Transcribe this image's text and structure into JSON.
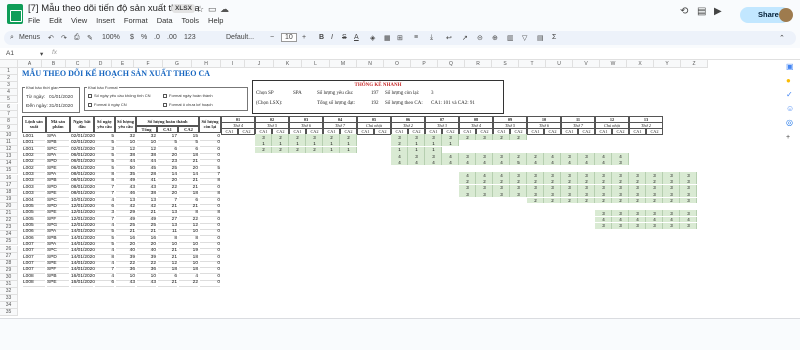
{
  "window": {
    "title": "[7] Mẫu theo dõi tiến độ sản xuất theo ca",
    "badge": "XLSX"
  },
  "menu": [
    "File",
    "Edit",
    "View",
    "Insert",
    "Format",
    "Data",
    "Tools",
    "Help"
  ],
  "share_label": "Share",
  "toolbar": {
    "menus": "Menus",
    "zoom": "100%",
    "format": "Default...",
    "font_size": "10",
    "num123": "123",
    "pct": "%"
  },
  "formula_bar": {
    "cell_ref": "A1",
    "fx": "fx"
  },
  "columns": [
    "A",
    "B",
    "C",
    "D",
    "E",
    "F",
    "G",
    "H",
    "I",
    "J",
    "K",
    "L",
    "M",
    "N",
    "O",
    "P",
    "Q",
    "R",
    "S",
    "T",
    "U",
    "V",
    "W",
    "X",
    "Y",
    "Z"
  ],
  "rows": [
    "1",
    "2",
    "3",
    "4",
    "5",
    "6",
    "7",
    "8",
    "9",
    "10",
    "11",
    "12",
    "13",
    "14",
    "15",
    "16",
    "17",
    "18",
    "19",
    "20",
    "21",
    "22",
    "23",
    "24",
    "25",
    "26",
    "27",
    "28",
    "29",
    "30",
    "31",
    "32",
    "33",
    "34",
    "35"
  ],
  "sheet": {
    "title": "MẪU THEO DÕI KẾ HOẠCH SẢN XUẤT THEO CA",
    "time_box": {
      "legend": "Khai báo thời gian",
      "from_label": "Từ ngày:",
      "from_value": "01/01/2020",
      "to_label": "Đến ngày:",
      "to_value": "31/01/2020"
    },
    "format_box": {
      "legend": "Khai báo Format",
      "opt1": "Số ngày yêu cầu không tính CN",
      "opt2": "Format ngày hoàn thành",
      "opt3": "Format ô ngày CN",
      "opt4": "Format ô chưa kế hoạch"
    },
    "stats": {
      "title": "THỐNG KÊ NHANH",
      "chon_sp": "Chọn SP",
      "sp_val": "SPA",
      "sl_yc": "Số lượng yêu cầu:",
      "sl_yc_val": "197",
      "sl_cl": "Số lượng còn lại:",
      "sl_cl_val": "3",
      "chon_lsx": "(Chọn LSX):",
      "tong": "Tổng số lượng đạt:",
      "tong_val": "192",
      "sl_ca": "Số lượng theo CA:",
      "sl_ca_val": "CA1: 101 và CA2: 91"
    },
    "headers": {
      "lenh": "Lệnh sản xuất",
      "ma": "Mã sản phẩm",
      "ngay": "Ngày bắt đầu",
      "songay": "Số ngày yêu cầu",
      "sl": "Số lượng yêu cầu",
      "slht": "Số lượng hoàn thành",
      "tong": "Tổng",
      "ca1": "CA1",
      "ca2": "CA2",
      "slcl": "Số lượng còn lại"
    },
    "dates": [
      "01",
      "02",
      "03",
      "04",
      "05",
      "06",
      "07",
      "08",
      "09",
      "10",
      "11",
      "12",
      "13"
    ],
    "days": [
      "Thứ 4",
      "Thứ 5",
      "Thứ 6",
      "Thứ 7",
      "Chủ nhật",
      "Thứ 2",
      "Thứ 3",
      "Thứ 4",
      "Thứ 5",
      "Thứ 6",
      "Thứ 7",
      "Chủ nhật",
      "Thứ 2"
    ],
    "data_rows": [
      [
        "L001",
        "SPA",
        "02/01/2020",
        "5",
        "32",
        "32",
        "17",
        "15",
        "0"
      ],
      [
        "L001",
        "SPB",
        "02/01/2020",
        "5",
        "10",
        "10",
        "5",
        "5",
        "0"
      ],
      [
        "L001",
        "SPC",
        "02/01/2020",
        "3",
        "12",
        "12",
        "6",
        "6",
        "0"
      ],
      [
        "L002",
        "SPA",
        "06/01/2020",
        "5",
        "38",
        "38",
        "20",
        "18",
        "0"
      ],
      [
        "L002",
        "SPD",
        "06/01/2020",
        "5",
        "44",
        "44",
        "23",
        "21",
        "0"
      ],
      [
        "L002",
        "SPE",
        "06/01/2020",
        "5",
        "50",
        "45",
        "25",
        "20",
        "5"
      ],
      [
        "L003",
        "SPA",
        "08/01/2020",
        "8",
        "35",
        "28",
        "14",
        "14",
        "7"
      ],
      [
        "L003",
        "SPB",
        "08/01/2020",
        "8",
        "49",
        "41",
        "20",
        "21",
        "8"
      ],
      [
        "L003",
        "SPD",
        "08/01/2020",
        "7",
        "43",
        "43",
        "22",
        "21",
        "0"
      ],
      [
        "L003",
        "SPE",
        "08/01/2020",
        "7",
        "46",
        "38",
        "20",
        "18",
        "8"
      ],
      [
        "L004",
        "SPC",
        "10/01/2020",
        "4",
        "13",
        "13",
        "7",
        "6",
        "0"
      ],
      [
        "L005",
        "SPD",
        "12/01/2020",
        "6",
        "42",
        "42",
        "21",
        "21",
        "0"
      ],
      [
        "L005",
        "SPE",
        "12/01/2020",
        "3",
        "29",
        "21",
        "13",
        "8",
        "8"
      ],
      [
        "L005",
        "SPF",
        "12/01/2020",
        "7",
        "49",
        "49",
        "27",
        "22",
        "0"
      ],
      [
        "L005",
        "SPG",
        "12/01/2020",
        "4",
        "25",
        "25",
        "13",
        "12",
        "0"
      ],
      [
        "L006",
        "SPA",
        "14/01/2020",
        "5",
        "21",
        "21",
        "11",
        "10",
        "0"
      ],
      [
        "L006",
        "SPB",
        "14/01/2020",
        "5",
        "16",
        "16",
        "8",
        "8",
        "0"
      ],
      [
        "L007",
        "SPA",
        "14/01/2020",
        "5",
        "20",
        "20",
        "10",
        "10",
        "0"
      ],
      [
        "L007",
        "SPC",
        "14/01/2020",
        "4",
        "40",
        "40",
        "21",
        "19",
        "0"
      ],
      [
        "L007",
        "SPD",
        "14/01/2020",
        "8",
        "39",
        "39",
        "21",
        "18",
        "0"
      ],
      [
        "L007",
        "SPE",
        "14/01/2020",
        "4",
        "22",
        "22",
        "12",
        "10",
        "0"
      ],
      [
        "L007",
        "SPF",
        "14/01/2020",
        "7",
        "36",
        "36",
        "18",
        "18",
        "0"
      ],
      [
        "L008",
        "SPB",
        "16/01/2020",
        "4",
        "10",
        "10",
        "6",
        "4",
        "0"
      ],
      [
        "L008",
        "SPE",
        "16/01/2020",
        "6",
        "43",
        "43",
        "21",
        "22",
        "0"
      ]
    ],
    "gantt": [
      {
        "row": 0,
        "start": 2,
        "vals": [
          "3",
          "2",
          "2",
          "3",
          "2",
          "2",
          "",
          "",
          "3",
          "3",
          "3",
          "3",
          "2",
          "3",
          "2",
          "2"
        ]
      },
      {
        "row": 1,
        "start": 2,
        "vals": [
          "1",
          "1",
          "1",
          "1",
          "1",
          "1",
          "",
          "",
          "2",
          "1",
          "1",
          "1"
        ]
      },
      {
        "row": 2,
        "start": 2,
        "vals": [
          "2",
          "2",
          "2",
          "2",
          "1",
          "1",
          "",
          "",
          "1",
          "1",
          "1"
        ]
      },
      {
        "row": 3,
        "start": 10,
        "vals": [
          "4",
          "3",
          "3",
          "4",
          "3",
          "3",
          "3",
          "2",
          "2",
          "4",
          "3",
          "3",
          "4",
          "4"
        ]
      },
      {
        "row": 4,
        "start": 10,
        "vals": [
          "4",
          "4",
          "4",
          "4",
          "4",
          "4",
          "4",
          "5",
          "4",
          "4",
          "4",
          "4",
          "4",
          "3"
        ]
      },
      {
        "row": 6,
        "start": 14,
        "vals": [
          "4",
          "4",
          "4",
          "3",
          "3",
          "3",
          "3",
          "3",
          "3",
          "3",
          "3",
          "3",
          "3",
          "3"
        ]
      },
      {
        "row": 7,
        "start": 14,
        "vals": [
          "2",
          "2",
          "2",
          "2",
          "2",
          "2",
          "2",
          "2",
          "2",
          "2",
          "2",
          "2",
          "3",
          "3"
        ]
      },
      {
        "row": 8,
        "start": 14,
        "vals": [
          "3",
          "3",
          "3",
          "3",
          "3",
          "3",
          "3",
          "3",
          "3",
          "3",
          "3",
          "3",
          "3",
          "3"
        ]
      },
      {
        "row": 9,
        "start": 14,
        "vals": [
          "3",
          "3",
          "3",
          "3",
          "3",
          "3",
          "3",
          "3",
          "3",
          "3",
          "3",
          "3",
          "3",
          "3"
        ]
      },
      {
        "row": 10,
        "start": 18,
        "vals": [
          "2",
          "2",
          "2",
          "2",
          "2",
          "2",
          "2",
          "2",
          "2",
          "3"
        ]
      },
      {
        "row": 12,
        "start": 22,
        "vals": [
          "3",
          "3",
          "3",
          "3",
          "3",
          "3"
        ]
      },
      {
        "row": 13,
        "start": 22,
        "vals": [
          "4",
          "4",
          "4",
          "4",
          "4",
          "4"
        ]
      },
      {
        "row": 14,
        "start": 22,
        "vals": [
          "3",
          "3",
          "3",
          "3",
          "3",
          "3"
        ]
      }
    ]
  }
}
